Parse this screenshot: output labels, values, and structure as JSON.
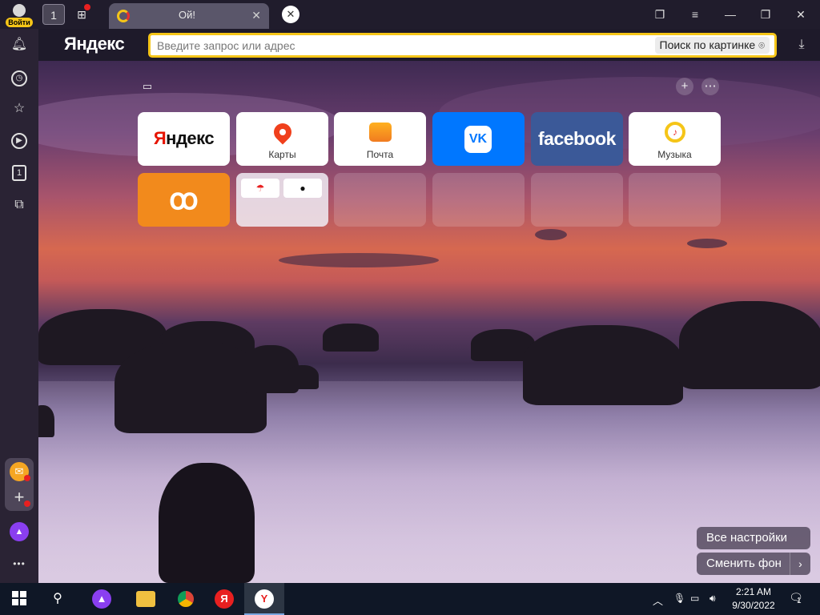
{
  "tabbar": {
    "user_label": "Войти",
    "tab_title": "Ой!",
    "home_tab_count": "1",
    "window_controls": [
      "collections-icon",
      "menu-icon",
      "minimize-icon",
      "restore-icon",
      "close-icon"
    ]
  },
  "topbar": {
    "logo": "Яндекс",
    "search_placeholder": "Введите запрос или адрес",
    "image_search_label": "Поиск по картинке"
  },
  "sidebar": {
    "items": [
      "bell-icon",
      "history-icon",
      "bookmarks-star-icon",
      "video-play-icon",
      "tab-count-icon",
      "screenshot-icon"
    ],
    "tab_count": "1"
  },
  "speed_dial": {
    "tiles": [
      {
        "name": "yandex",
        "label": "Яндекс"
      },
      {
        "name": "maps",
        "label": "Карты"
      },
      {
        "name": "mail",
        "label": "Почта"
      },
      {
        "name": "vk",
        "label": "VK"
      },
      {
        "name": "facebook",
        "label": "facebook"
      },
      {
        "name": "music",
        "label": "Музыка"
      },
      {
        "name": "odnoklassniki",
        "label": "ok"
      }
    ]
  },
  "buttons": {
    "all_settings": "Все настройки",
    "change_background": "Сменить фон"
  },
  "taskbar": {
    "time": "2:21 AM",
    "date": "9/30/2022",
    "notifications_count": "1"
  },
  "colors": {
    "accent_yellow": "#f5c518",
    "vk_blue": "#0077ff",
    "facebook_blue": "#3b5998",
    "ok_orange": "#f28a1c"
  }
}
